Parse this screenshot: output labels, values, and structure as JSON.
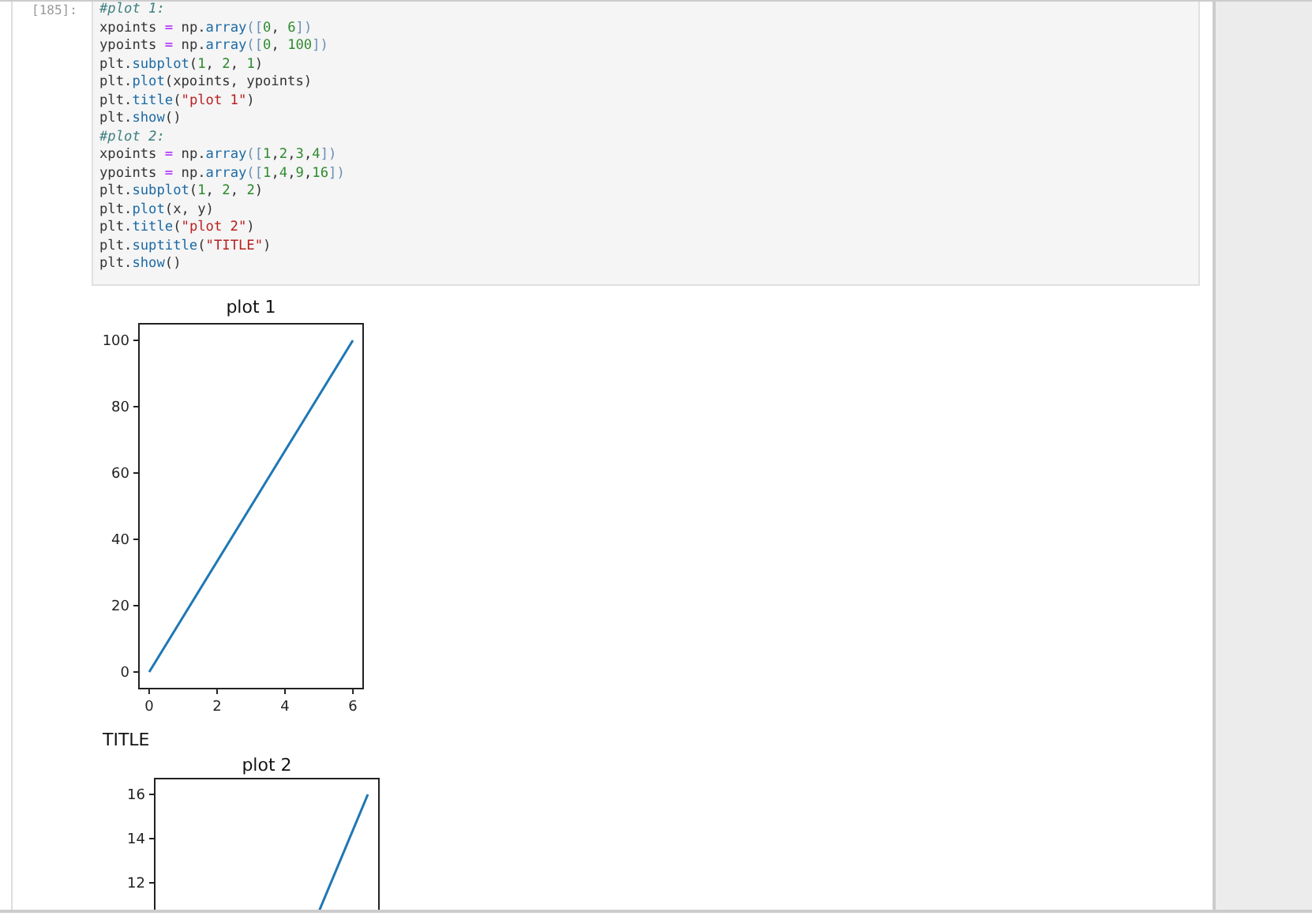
{
  "cell": {
    "prompt": "[185]:",
    "code_lines": [
      [
        {
          "t": "#plot 1:",
          "kind": "comment"
        }
      ],
      [
        {
          "t": "xpoints ",
          "kind": "name"
        },
        {
          "t": "=",
          "kind": "op"
        },
        {
          "t": " np.",
          "kind": "name"
        },
        {
          "t": "array",
          "kind": "func"
        },
        {
          "t": "([",
          "kind": "bracket"
        },
        {
          "t": "0",
          "kind": "num"
        },
        {
          "t": ", ",
          "kind": "name"
        },
        {
          "t": "6",
          "kind": "num"
        },
        {
          "t": "])",
          "kind": "bracket"
        }
      ],
      [
        {
          "t": "ypoints ",
          "kind": "name"
        },
        {
          "t": "=",
          "kind": "op"
        },
        {
          "t": " np.",
          "kind": "name"
        },
        {
          "t": "array",
          "kind": "func"
        },
        {
          "t": "([",
          "kind": "bracket"
        },
        {
          "t": "0",
          "kind": "num"
        },
        {
          "t": ", ",
          "kind": "name"
        },
        {
          "t": "100",
          "kind": "num"
        },
        {
          "t": "])",
          "kind": "bracket"
        }
      ],
      [
        {
          "t": "plt.",
          "kind": "name"
        },
        {
          "t": "subplot",
          "kind": "func"
        },
        {
          "t": "(",
          "kind": "name"
        },
        {
          "t": "1",
          "kind": "num"
        },
        {
          "t": ", ",
          "kind": "name"
        },
        {
          "t": "2",
          "kind": "num"
        },
        {
          "t": ", ",
          "kind": "name"
        },
        {
          "t": "1",
          "kind": "num"
        },
        {
          "t": ")",
          "kind": "name"
        }
      ],
      [
        {
          "t": "plt.",
          "kind": "name"
        },
        {
          "t": "plot",
          "kind": "func"
        },
        {
          "t": "(xpoints, ypoints)",
          "kind": "name"
        }
      ],
      [
        {
          "t": "plt.",
          "kind": "name"
        },
        {
          "t": "title",
          "kind": "func"
        },
        {
          "t": "(",
          "kind": "name"
        },
        {
          "t": "\"plot 1\"",
          "kind": "str"
        },
        {
          "t": ")",
          "kind": "name"
        }
      ],
      [
        {
          "t": "plt.",
          "kind": "name"
        },
        {
          "t": "show",
          "kind": "func"
        },
        {
          "t": "()",
          "kind": "name"
        }
      ],
      [
        {
          "t": "#plot 2:",
          "kind": "comment"
        }
      ],
      [
        {
          "t": "xpoints ",
          "kind": "name"
        },
        {
          "t": "=",
          "kind": "op"
        },
        {
          "t": " np.",
          "kind": "name"
        },
        {
          "t": "array",
          "kind": "func"
        },
        {
          "t": "([",
          "kind": "bracket"
        },
        {
          "t": "1",
          "kind": "num"
        },
        {
          "t": ",",
          "kind": "name"
        },
        {
          "t": "2",
          "kind": "num"
        },
        {
          "t": ",",
          "kind": "name"
        },
        {
          "t": "3",
          "kind": "num"
        },
        {
          "t": ",",
          "kind": "name"
        },
        {
          "t": "4",
          "kind": "num"
        },
        {
          "t": "])",
          "kind": "bracket"
        }
      ],
      [
        {
          "t": "ypoints ",
          "kind": "name"
        },
        {
          "t": "=",
          "kind": "op"
        },
        {
          "t": " np.",
          "kind": "name"
        },
        {
          "t": "array",
          "kind": "func"
        },
        {
          "t": "([",
          "kind": "bracket"
        },
        {
          "t": "1",
          "kind": "num"
        },
        {
          "t": ",",
          "kind": "name"
        },
        {
          "t": "4",
          "kind": "num"
        },
        {
          "t": ",",
          "kind": "name"
        },
        {
          "t": "9",
          "kind": "num"
        },
        {
          "t": ",",
          "kind": "name"
        },
        {
          "t": "16",
          "kind": "num"
        },
        {
          "t": "])",
          "kind": "bracket"
        }
      ],
      [
        {
          "t": "plt.",
          "kind": "name"
        },
        {
          "t": "subplot",
          "kind": "func"
        },
        {
          "t": "(",
          "kind": "name"
        },
        {
          "t": "1",
          "kind": "num"
        },
        {
          "t": ", ",
          "kind": "name"
        },
        {
          "t": "2",
          "kind": "num"
        },
        {
          "t": ", ",
          "kind": "name"
        },
        {
          "t": "2",
          "kind": "num"
        },
        {
          "t": ")",
          "kind": "name"
        }
      ],
      [
        {
          "t": "plt.",
          "kind": "name"
        },
        {
          "t": "plot",
          "kind": "func"
        },
        {
          "t": "(x, y)",
          "kind": "name"
        }
      ],
      [
        {
          "t": "plt.",
          "kind": "name"
        },
        {
          "t": "title",
          "kind": "func"
        },
        {
          "t": "(",
          "kind": "name"
        },
        {
          "t": "\"plot 2\"",
          "kind": "str"
        },
        {
          "t": ")",
          "kind": "name"
        }
      ],
      [
        {
          "t": "plt.",
          "kind": "name"
        },
        {
          "t": "suptitle",
          "kind": "func"
        },
        {
          "t": "(",
          "kind": "name"
        },
        {
          "t": "\"TITLE\"",
          "kind": "str"
        },
        {
          "t": ")",
          "kind": "name"
        }
      ],
      [
        {
          "t": "plt.",
          "kind": "name"
        },
        {
          "t": "show",
          "kind": "func"
        },
        {
          "t": "()",
          "kind": "name"
        }
      ]
    ]
  },
  "output": {
    "plot_1": {
      "chart_data": {
        "type": "line",
        "title": "plot 1",
        "x": [
          0,
          6
        ],
        "series": [
          {
            "color": "#1f77b4",
            "values": [
              0,
              100
            ]
          }
        ],
        "xlim": [
          -0.3,
          6.3
        ],
        "ylim": [
          -5,
          105
        ],
        "xticks": [
          0,
          2,
          4,
          6
        ],
        "yticks": [
          0,
          20,
          40,
          60,
          80,
          100
        ]
      }
    },
    "suptitle": "TITLE",
    "plot_2": {
      "title": "plot 2",
      "y_tick_labels": [
        "16",
        "14",
        "12"
      ]
    }
  }
}
